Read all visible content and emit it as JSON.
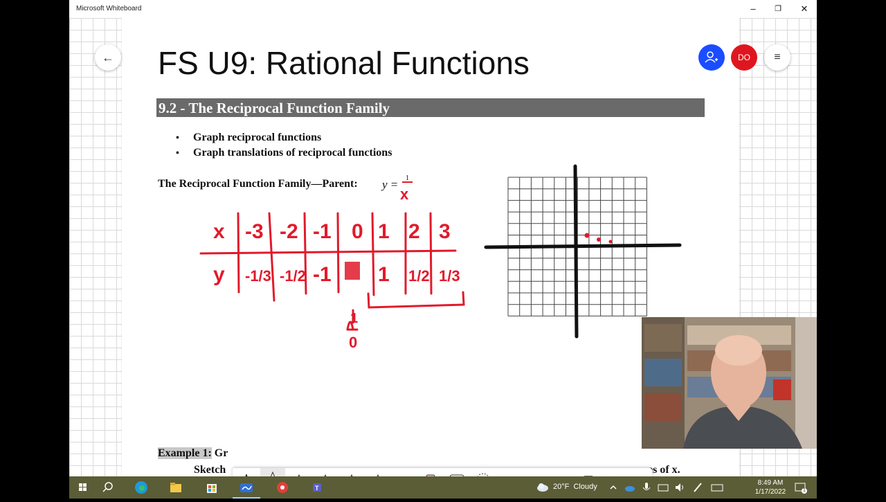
{
  "window": {
    "app_title": "Microsoft Whiteboard",
    "minimize": "–",
    "restore": "❐",
    "close": "✕"
  },
  "header": {
    "back_icon": "←",
    "invite_icon": "invite-person-icon",
    "avatar_initials": "DO",
    "menu_icon": "≡"
  },
  "document": {
    "title": "FS U9: Rational Functions",
    "section_title": "9.2 - The Reciprocal Function Family",
    "objectives": [
      "Graph reciprocal functions",
      "Graph translations of reciprocal functions"
    ],
    "bullet": "•",
    "parent_label": "The Reciprocal Function Family—Parent:",
    "parent_eq_left": "y =",
    "parent_eq_numerator": "1",
    "example_label": "Example 1:",
    "example_rest": "Gr",
    "sketch_label": "Sketch",
    "sketch_tail": "es of x."
  },
  "handwriting": {
    "header_row": [
      "x",
      "-3",
      "-2",
      "-1",
      "0",
      "1",
      "2",
      "3"
    ],
    "value_row": [
      "y",
      "-1/3",
      "-1/2",
      "-1",
      "",
      "1",
      "1/2",
      "1/3"
    ],
    "denominator_x": "x",
    "side_note_numerator": "1",
    "side_note_denominator": "0",
    "ink_color": "#e11a2b"
  },
  "toolbar": {
    "tools": [
      "black-pen",
      "red-pen",
      "yellow-pen",
      "rainbow-pen",
      "galaxy-pen",
      "blue-pen",
      "highlighter",
      "eraser",
      "ruler",
      "lasso",
      "text",
      "sticky-note",
      "image",
      "add",
      "undo",
      "redo"
    ],
    "text_tool_label": "A"
  },
  "taskbar": {
    "weather_temp": "20°F",
    "weather_desc": "Cloudy",
    "time": "8:49 AM",
    "date": "1/17/2022",
    "notification_count": "1"
  }
}
